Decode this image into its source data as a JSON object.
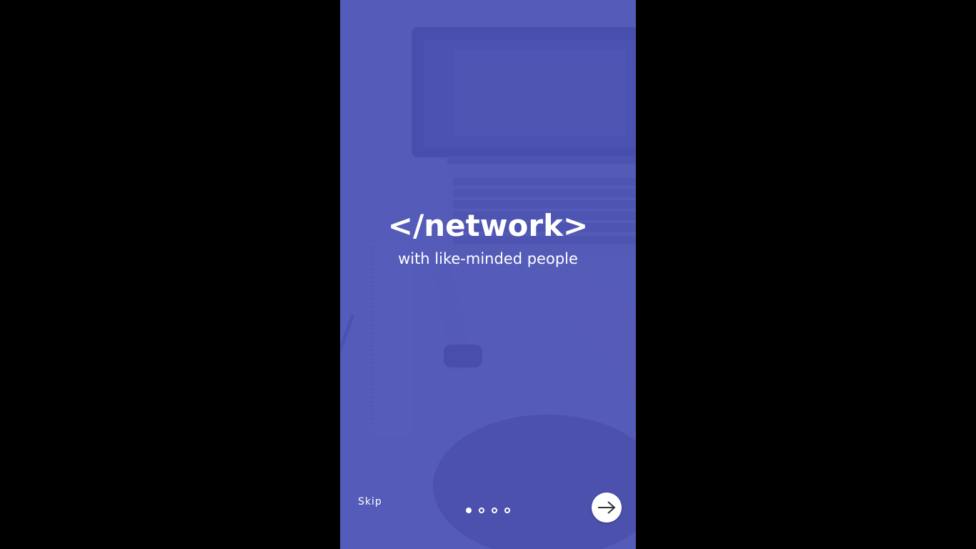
{
  "onboarding": {
    "title": "</network>",
    "subtitle": "with like-minded people",
    "skip_label": "Skip",
    "pagination": {
      "total": 4,
      "current": 1
    },
    "next_icon": "arrow-right-icon",
    "background_image": "laptop-workspace-photo"
  },
  "colors": {
    "screen_background": "#000000",
    "overlay": "#5157b4",
    "text": "#ffffff",
    "next_button_bg": "#ffffff",
    "next_arrow": "#333333"
  }
}
